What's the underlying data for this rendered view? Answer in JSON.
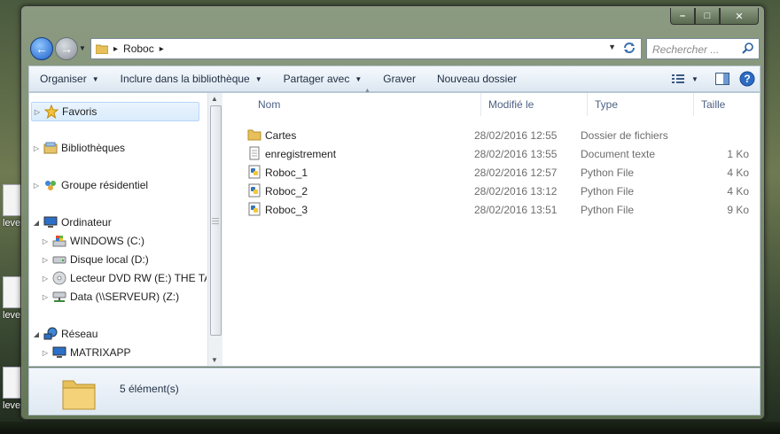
{
  "desktop": {
    "icons": [
      {
        "label": "leve"
      },
      {
        "label": "leve"
      },
      {
        "label": "leve"
      }
    ]
  },
  "window": {
    "controls": {
      "minimize": "–",
      "maximize": "□",
      "close": "✕"
    }
  },
  "address_bar": {
    "crumbs": [
      "Roboc"
    ],
    "separator": "▸"
  },
  "search": {
    "placeholder": "Rechercher ..."
  },
  "toolbar": {
    "organize": "Organiser",
    "include": "Inclure dans la bibliothèque",
    "share": "Partager avec",
    "burn": "Graver",
    "new_folder": "Nouveau dossier"
  },
  "nav_tree": {
    "favorites": "Favoris",
    "libraries": "Bibliothèques",
    "homegroup": "Groupe résidentiel",
    "computer": "Ordinateur",
    "drives": [
      {
        "label": "WINDOWS (C:)"
      },
      {
        "label": "Disque local (D:)"
      },
      {
        "label": "Lecteur DVD RW (E:) THE TA"
      },
      {
        "label": "Data (\\\\SERVEUR) (Z:)"
      }
    ],
    "network": "Réseau",
    "network_items": [
      {
        "label": "MATRIXAPP"
      }
    ]
  },
  "columns": {
    "name": "Nom",
    "modified": "Modifié le",
    "type": "Type",
    "size": "Taille"
  },
  "files": [
    {
      "name": "Cartes",
      "modified": "28/02/2016 12:55",
      "type": "Dossier de fichiers",
      "size": "",
      "icon": "folder-icon"
    },
    {
      "name": "enregistrement",
      "modified": "28/02/2016 13:55",
      "type": "Document texte",
      "size": "1 Ko",
      "icon": "text-file-icon"
    },
    {
      "name": "Roboc_1",
      "modified": "28/02/2016 12:57",
      "type": "Python File",
      "size": "4 Ko",
      "icon": "python-file-icon"
    },
    {
      "name": "Roboc_2",
      "modified": "28/02/2016 13:12",
      "type": "Python File",
      "size": "4 Ko",
      "icon": "python-file-icon"
    },
    {
      "name": "Roboc_3",
      "modified": "28/02/2016 13:51",
      "type": "Python File",
      "size": "9 Ko",
      "icon": "python-file-icon"
    }
  ],
  "details": {
    "count": "5 élément(s)"
  }
}
